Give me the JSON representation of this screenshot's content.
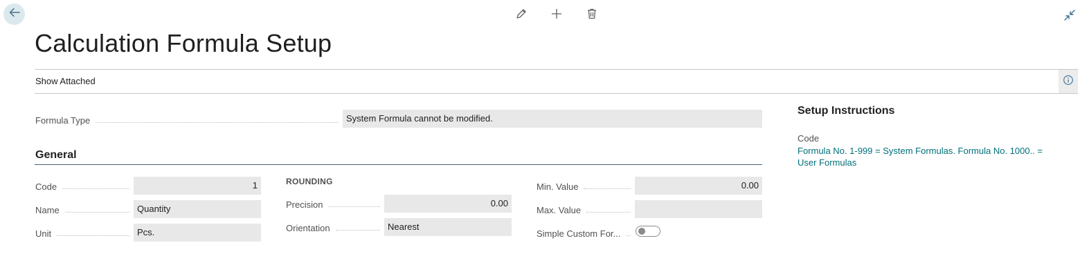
{
  "toolbar": {
    "back_icon": "arrow-left-icon",
    "edit_icon": "pencil-icon",
    "new_icon": "plus-icon",
    "delete_icon": "trash-icon",
    "collapse_icon": "collapse-arrows-icon"
  },
  "page": {
    "title": "Calculation Formula Setup"
  },
  "action_bar": {
    "show_attached": "Show Attached",
    "info_icon": "info-icon"
  },
  "formula_type": {
    "label": "Formula Type",
    "value": "System Formula cannot be modified."
  },
  "general": {
    "title": "General",
    "code": {
      "label": "Code",
      "value": "1"
    },
    "name": {
      "label": "Name",
      "value": "Quantity"
    },
    "unit": {
      "label": "Unit",
      "value": "Pcs."
    },
    "rounding_caption": "ROUNDING",
    "precision": {
      "label": "Precision",
      "value": "0.00"
    },
    "orientation": {
      "label": "Orientation",
      "value": "Nearest"
    },
    "min_value": {
      "label": "Min. Value",
      "value": "0.00"
    },
    "max_value": {
      "label": "Max. Value",
      "value": ""
    },
    "simple_custom": {
      "label": "Simple Custom For...",
      "enabled": false
    }
  },
  "factbox": {
    "title": "Setup Instructions",
    "code_label": "Code",
    "code_text": "Formula No. 1-999 = System Formulas. Formula No. 1000.. = User Formulas"
  },
  "colors": {
    "accent": "#00707a",
    "field_bg": "#e8e8e9",
    "back_button_bg": "#dbe9ef"
  }
}
